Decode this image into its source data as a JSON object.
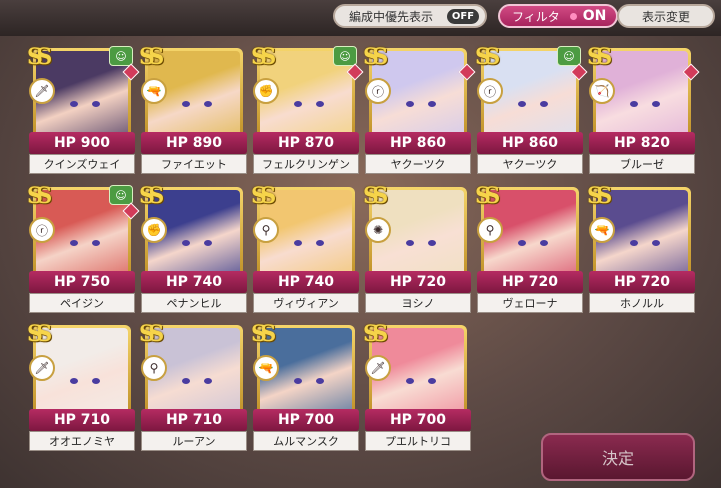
{
  "topbar": {
    "priority_label": "編成中優先表示",
    "priority_state": "OFF",
    "filter_label": "フィルタ",
    "filter_state": "ON",
    "display_change_label": "表示変更"
  },
  "cards": [
    {
      "hp": "HP 900",
      "name": "クインズウェイ",
      "weapon": "🗡",
      "green": true,
      "red": true,
      "hair": "#4b3a63",
      "skin": "#f3d1c2"
    },
    {
      "hp": "HP 890",
      "name": "ファイエット",
      "weapon": "🔫",
      "green": false,
      "red": false,
      "hair": "#e0b84e",
      "skin": "#f6d8c7"
    },
    {
      "hp": "HP 870",
      "name": "フェルクリンゲン",
      "weapon": "✊",
      "green": true,
      "red": true,
      "hair": "#f1d27c",
      "skin": "#f8dccf"
    },
    {
      "hp": "HP 860",
      "name": "ヤクーツク",
      "weapon": "ⓡ",
      "green": false,
      "red": true,
      "hair": "#cfc8ee",
      "skin": "#f7ddd6"
    },
    {
      "hp": "HP 860",
      "name": "ヤクーツク",
      "weapon": "ⓡ",
      "green": true,
      "red": true,
      "hair": "#d9e0f2",
      "skin": "#f7ddd6"
    },
    {
      "hp": "HP 820",
      "name": "ブルーゼ",
      "weapon": "🏹",
      "green": false,
      "red": true,
      "hair": "#e0b1d8",
      "skin": "#f8dde0"
    },
    {
      "hp": "HP 750",
      "name": "ペイジン",
      "weapon": "ⓡ",
      "green": true,
      "red": true,
      "hair": "#d85a55",
      "skin": "#f5d3c7"
    },
    {
      "hp": "HP 740",
      "name": "ペナンヒル",
      "weapon": "✊",
      "green": false,
      "red": false,
      "hair": "#3c3f8e",
      "skin": "#f5d6cb"
    },
    {
      "hp": "HP 740",
      "name": "ヴィヴィアン",
      "weapon": "⚲",
      "green": false,
      "red": false,
      "hair": "#f2c670",
      "skin": "#f8dccf"
    },
    {
      "hp": "HP 720",
      "name": "ヨシノ",
      "weapon": "✺",
      "green": false,
      "red": false,
      "hair": "#efe0c0",
      "skin": "#f8e0d4"
    },
    {
      "hp": "HP 720",
      "name": "ヴェローナ",
      "weapon": "⚲",
      "green": false,
      "red": false,
      "hair": "#d8506a",
      "skin": "#f7d8cc"
    },
    {
      "hp": "HP 720",
      "name": "ホノルル",
      "weapon": "🔫",
      "green": false,
      "red": false,
      "hair": "#5a4c8f",
      "skin": "#f5d6cb"
    },
    {
      "hp": "HP 710",
      "name": "オオエノミヤ",
      "weapon": "🗡",
      "green": false,
      "red": false,
      "hair": "#f2ece8",
      "skin": "#f8e2da"
    },
    {
      "hp": "HP 710",
      "name": "ルーアン",
      "weapon": "⚲",
      "green": false,
      "red": false,
      "hair": "#c9c2d6",
      "skin": "#f6dcd2"
    },
    {
      "hp": "HP 700",
      "name": "ムルマンスク",
      "weapon": "🔫",
      "green": false,
      "red": false,
      "hair": "#4a6e9c",
      "skin": "#f4d4c6"
    },
    {
      "hp": "HP 700",
      "name": "プエルトリコ",
      "weapon": "🗡",
      "green": false,
      "red": false,
      "hair": "#ef8a9a",
      "skin": "#f8dcd3"
    }
  ],
  "decide_label": "決定",
  "rank_symbol": "SS",
  "party_badge_icon": "person-icon"
}
